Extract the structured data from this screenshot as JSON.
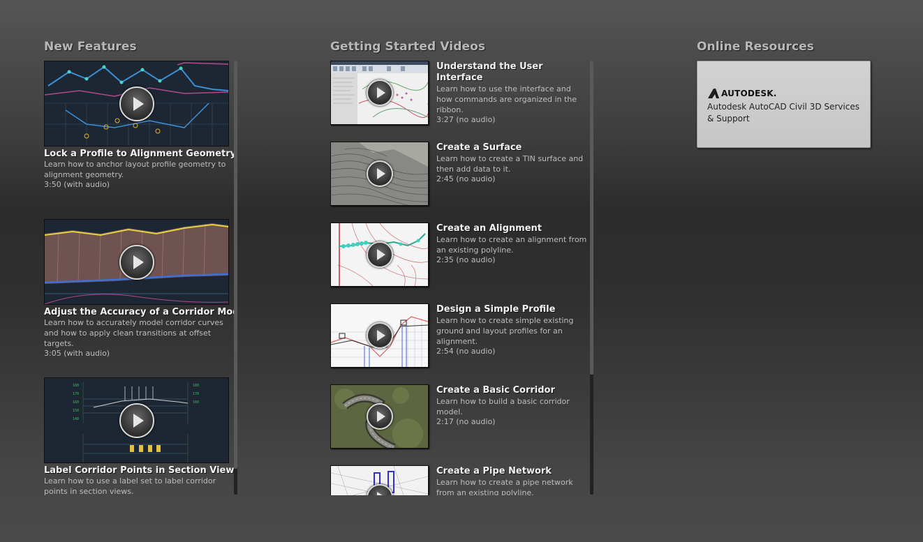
{
  "columns": {
    "new_features_title": "New Features",
    "getting_started_title": "Getting Started Videos",
    "online_resources_title": "Online Resources"
  },
  "new_features": [
    {
      "title": "Lock a Profile to Alignment Geometry",
      "desc": "Learn how to anchor layout profile geometry to alignment geometry.",
      "duration": "3:50 (with audio)"
    },
    {
      "title": "Adjust the Accuracy of a Corridor Model",
      "desc": "Learn how to accurately model corridor curves and how to apply clean transitions at offset targets.",
      "duration": "3:05 (with audio)"
    },
    {
      "title": "Label Corridor Points in Section Views",
      "desc": "Learn how to use a label set to label corridor points in section views.",
      "duration": ""
    }
  ],
  "getting_started": [
    {
      "title": "Understand the User Interface",
      "desc": "Learn how to use the interface and how commands are organized in the ribbon.",
      "duration": "3:27 (no audio)"
    },
    {
      "title": "Create a Surface",
      "desc": "Learn how to create a TIN surface and then add data to it.",
      "duration": "2:45 (no audio)"
    },
    {
      "title": "Create an Alignment",
      "desc": "Learn how to create an alignment from an existing polyline.",
      "duration": "2:35 (no audio)"
    },
    {
      "title": "Design a Simple Profile",
      "desc": "Learn how to create simple existing ground and layout profiles for an alignment.",
      "duration": "2:54 (no audio)"
    },
    {
      "title": "Create a Basic Corridor",
      "desc": "Learn how to build a basic corridor model.",
      "duration": "2:17 (no audio)"
    },
    {
      "title": "Create a Pipe Network",
      "desc": "Learn how to create a pipe network from an existing polyline.",
      "duration": ""
    }
  ],
  "online_resources": {
    "logo_text": "AUTODESK.",
    "label": "Autodesk AutoCAD Civil 3D Services & Support"
  },
  "icons": {
    "play": "play-icon",
    "logo": "autodesk-logo-icon"
  }
}
